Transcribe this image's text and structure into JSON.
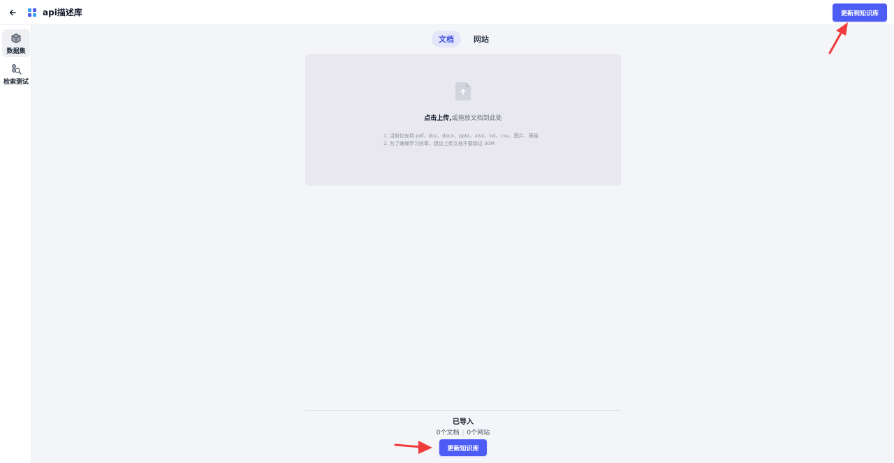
{
  "header": {
    "title": "api描述库",
    "update_button": "更新到知识库"
  },
  "sidebar": {
    "items": [
      {
        "label": "数据集",
        "icon": "cube-icon",
        "active": true
      },
      {
        "label": "检索测试",
        "icon": "search-test-icon",
        "active": false
      }
    ]
  },
  "tabs": [
    {
      "label": "文档",
      "active": true
    },
    {
      "label": "网站",
      "active": false
    }
  ],
  "upload": {
    "main_bold": "点击上传,",
    "main_rest": "或拖放文档到此处",
    "hints": [
      "1. 当前仅支持 pdf、doc、docx、pptx、xlsx、txt、csv、图片、表格",
      "2. 为了确保学习效率，建议上传文档不要超过 30M"
    ]
  },
  "imported": {
    "title": "已导入",
    "docs": "0个文档",
    "sites": "0个网站"
  },
  "bottom_button": "更新知识库",
  "colors": {
    "primary": "#4c5cf5",
    "tab_active_bg": "#e3e6f9",
    "annotation_arrow": "#ef3b3b"
  }
}
